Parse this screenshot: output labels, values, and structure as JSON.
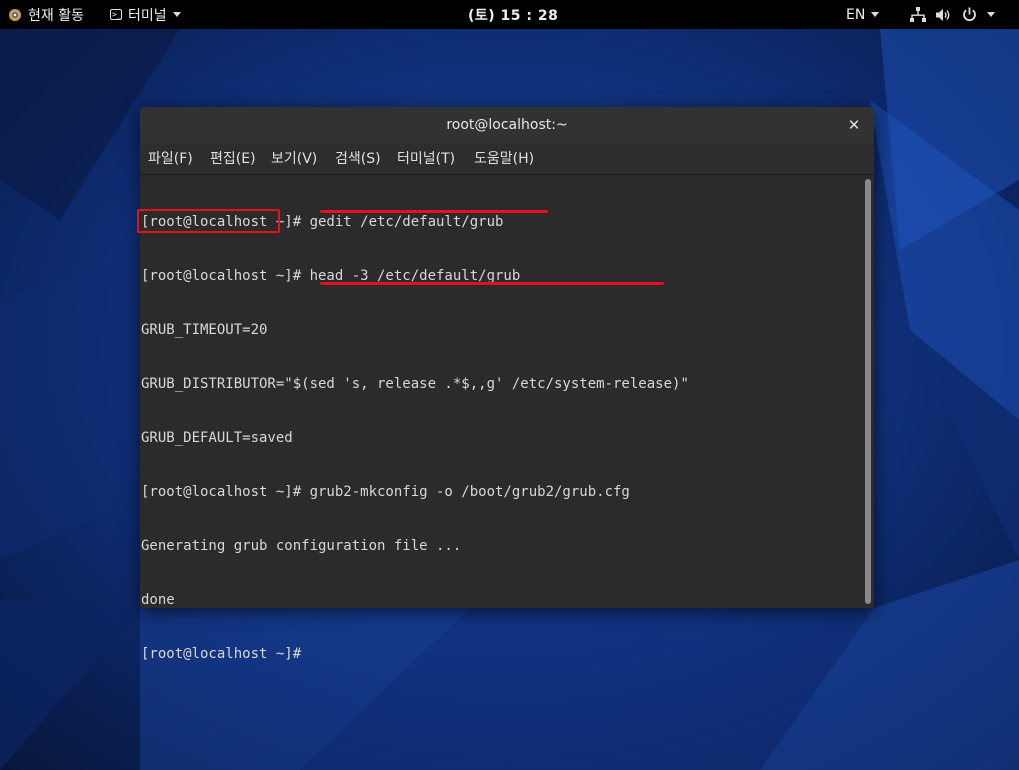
{
  "topbar": {
    "activities_label": "현재 활동",
    "app_menu_label": "터미널",
    "clock": "(토) 15 : 28",
    "language": "EN"
  },
  "window": {
    "title": "root@localhost:~",
    "close_glyph": "✕",
    "menus": [
      "파일(F)",
      "편집(E)",
      "보기(V)",
      "검색(S)",
      "터미널(T)",
      "도움말(H)"
    ]
  },
  "terminal": {
    "lines": [
      "[root@localhost ~]# gedit /etc/default/grub",
      "[root@localhost ~]# head -3 /etc/default/grub",
      "GRUB_TIMEOUT=20",
      "GRUB_DISTRIBUTOR=\"$(sed 's, release .*$,,g' /etc/system-release)\"",
      "GRUB_DEFAULT=saved",
      "[root@localhost ~]# grub2-mkconfig -o /boot/grub2/grub.cfg",
      "Generating grub configuration file ...",
      "done",
      "[root@localhost ~]#"
    ]
  },
  "colors": {
    "annotation": "#e4121e",
    "desktop": "#0b1f4d",
    "terminal_bg": "#2b2b2b"
  },
  "icons": [
    "fedora-logo-icon",
    "terminal-icon",
    "network-icon",
    "volume-icon",
    "power-icon"
  ]
}
